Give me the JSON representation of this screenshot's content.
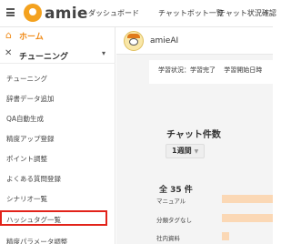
{
  "app": {
    "name": "amie"
  },
  "topnav": [
    "ダッシュボード",
    "チャットボット一覧",
    "チャット状況確認"
  ],
  "sidebar": {
    "home": "ホーム",
    "tuning": "チューニング",
    "items": [
      "チューニング",
      "辞書データ追加",
      "QA自動生成",
      "精度アップ登録",
      "ポイント調整",
      "よくある質問登録",
      "シナリオ一覧",
      "ハッシュタグ一覧",
      "精度パラメータ調整"
    ],
    "highlighted": "ハッシュタグ一覧"
  },
  "user": {
    "name": "amieAI"
  },
  "status": {
    "text": "学習状況：学習完了　 学習開始日時"
  },
  "chat": {
    "title": "チャット件数",
    "period": "1週間",
    "total": "全 35 件",
    "rows": [
      "マニュアル",
      "分類タグなし",
      "社内資料"
    ]
  },
  "colors": {
    "accent": "#f08c1a",
    "highlight_border": "#e2231a",
    "bar": "#fbd8b5"
  }
}
